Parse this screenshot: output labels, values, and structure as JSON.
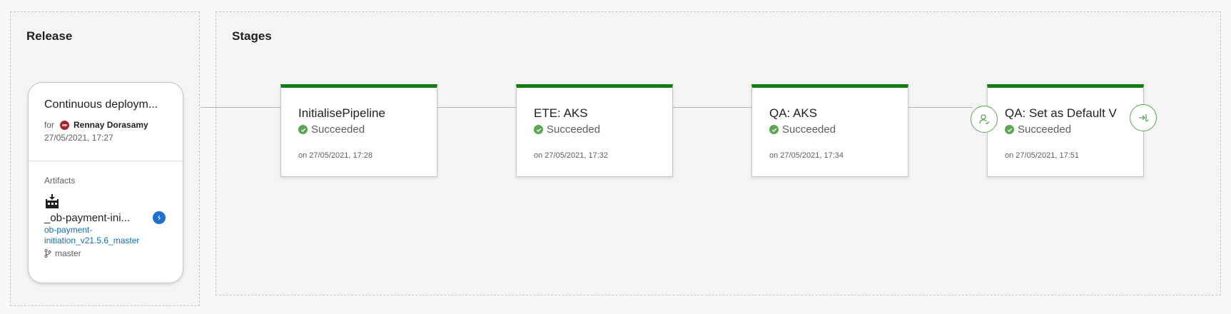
{
  "release": {
    "title": "Release",
    "card": {
      "name": "Continuous deploym...",
      "for_label": "for",
      "user": "Rennay Dorasamy",
      "date": "27/05/2021, 17:27",
      "artifacts_label": "Artifacts",
      "artifact_name": "_ob-payment-ini...",
      "artifact_version": "ob-payment-initiation_v21.5.6_master",
      "branch": "master"
    }
  },
  "stages": {
    "title": "Stages",
    "items": [
      {
        "name": "InitialisePipeline",
        "status": "Succeeded",
        "time": "on 27/05/2021, 17:28"
      },
      {
        "name": "ETE: AKS",
        "status": "Succeeded",
        "time": "on 27/05/2021, 17:32"
      },
      {
        "name": "QA: AKS",
        "status": "Succeeded",
        "time": "on 27/05/2021, 17:34"
      },
      {
        "name": "QA: Set as Default V",
        "status": "Succeeded",
        "time": "on 27/05/2021, 17:51"
      }
    ]
  },
  "colors": {
    "success": "#107c10",
    "success_icon": "#5ba653",
    "link": "#106ebe"
  },
  "icons": [
    "avatar",
    "artifact-build-icon",
    "git-branch-icon",
    "succeeded-icon",
    "pre-deployment-approval-icon",
    "post-deployment-gate-icon",
    "azure-repos-badge-icon"
  ]
}
